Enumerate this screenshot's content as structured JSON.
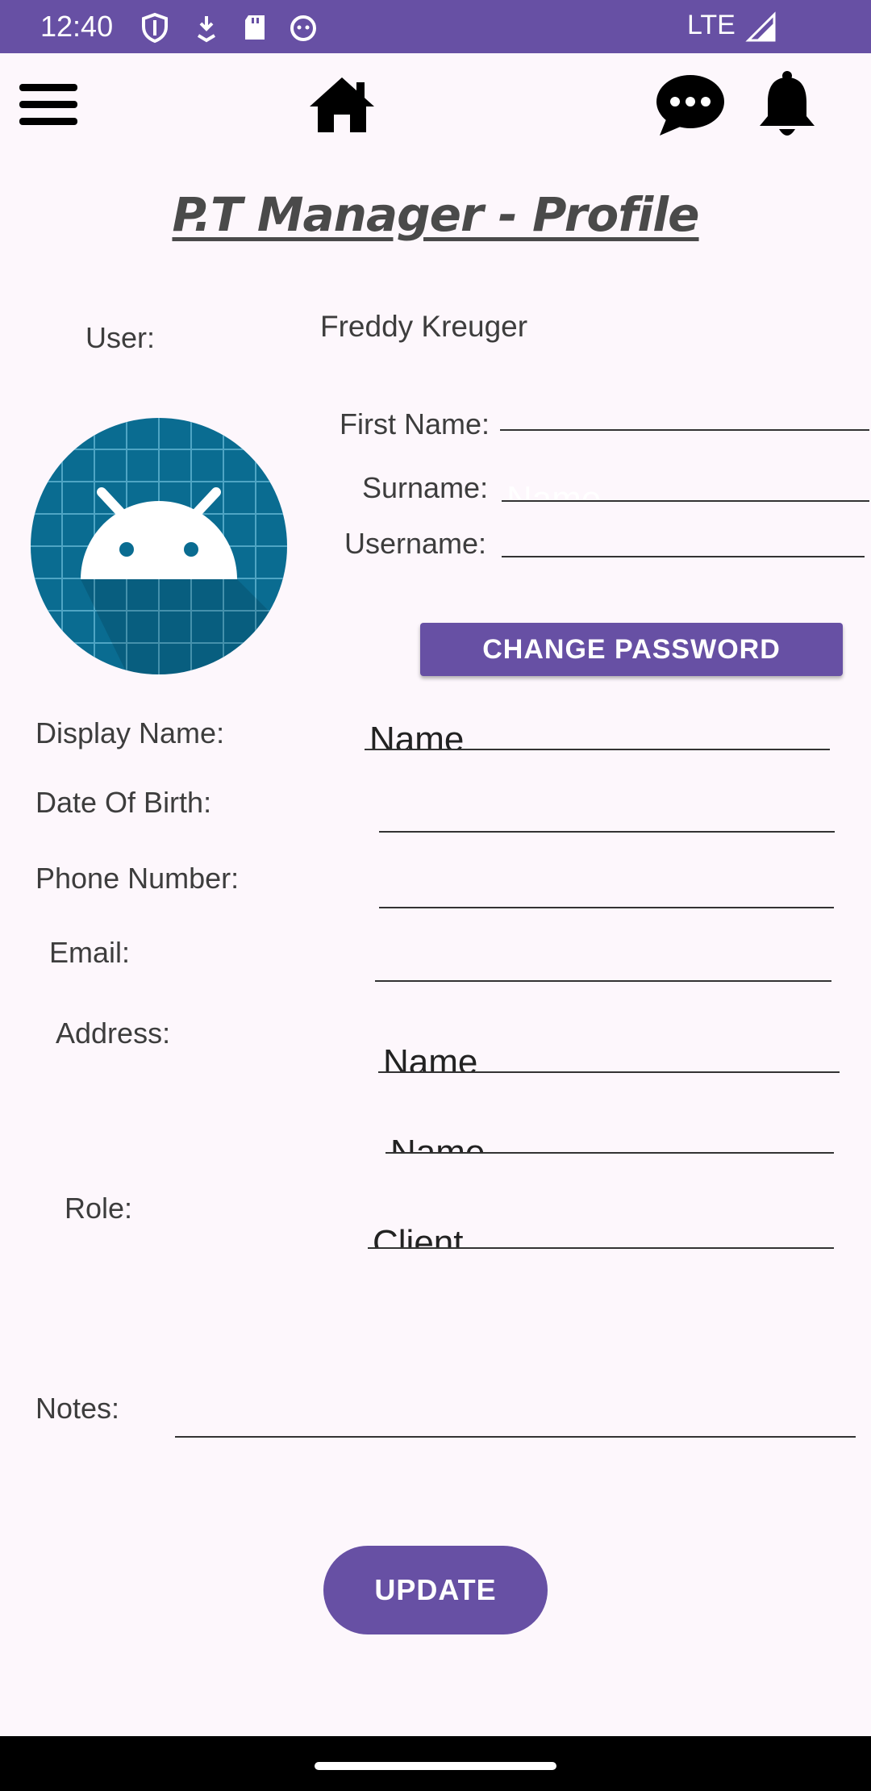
{
  "status_bar": {
    "time": "12:40",
    "network": "LTE",
    "icons": [
      "shield-icon",
      "download-icon",
      "sd-card-icon",
      "cat-face-icon",
      "signal-icon"
    ]
  },
  "toolbar": {
    "icons": [
      "menu-icon",
      "home-icon",
      "chat-icon",
      "bell-icon"
    ]
  },
  "page": {
    "title": "P.T Manager - Profile"
  },
  "user": {
    "label": "User:",
    "value": "Freddy Kreuger"
  },
  "fields": {
    "first_name": {
      "label": "First Name:",
      "value": ""
    },
    "surname": {
      "label": "Surname:",
      "value": "Name"
    },
    "username": {
      "label": "Username:",
      "value": ""
    },
    "display_name": {
      "label": "Display Name:",
      "value": "Name"
    },
    "date_of_birth": {
      "label": "Date Of Birth:",
      "value": ""
    },
    "phone_number": {
      "label": "Phone Number:",
      "value": ""
    },
    "email": {
      "label": "Email:",
      "value": ""
    },
    "address": {
      "label": "Address:",
      "line1": "Name",
      "line2": "Name"
    },
    "role": {
      "label": "Role:",
      "value": "Client"
    },
    "notes": {
      "label": "Notes:",
      "value": ""
    }
  },
  "buttons": {
    "change_password": "CHANGE PASSWORD",
    "update": "UPDATE"
  },
  "colors": {
    "accent": "#6750A4",
    "background": "#FDF7FC",
    "avatar_bg": "#0A6C91"
  }
}
